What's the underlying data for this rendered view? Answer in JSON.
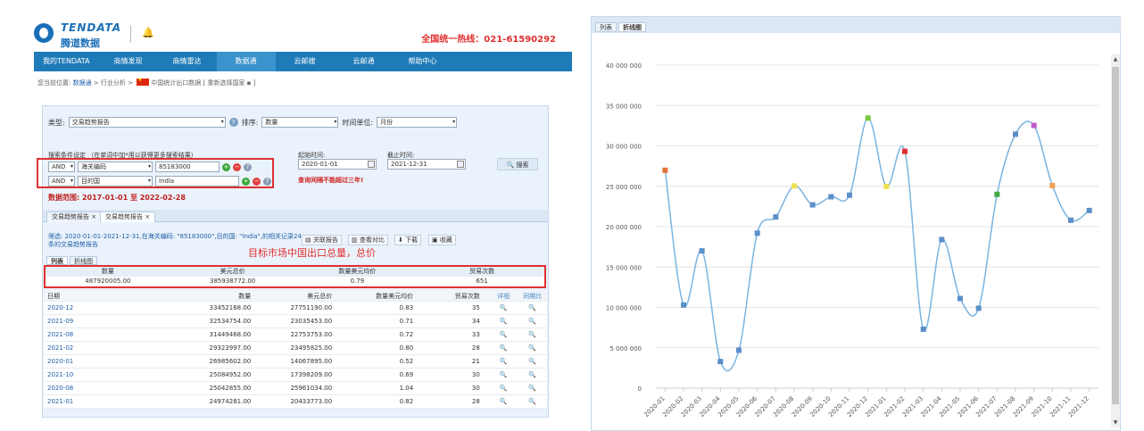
{
  "header": {
    "logo_en": "TENDATA",
    "logo_cn": "腾道数据",
    "hotline": "全国统一热线：021-61590292"
  },
  "nav": [
    "我的TENDATA",
    "商情发现",
    "商情雷达",
    "数据通",
    "云邮搜",
    "云邮通",
    "帮助中心"
  ],
  "nav_active": 3,
  "breadcrumb": {
    "prefix": "您当前位置:",
    "link1": "数据通",
    "sep1": " > ",
    "text2": "行业分析",
    "sep2": " > ",
    "text3": "中国统计出口数据",
    "reselect": "[ 重新选择国家 ▪ ]"
  },
  "filters": {
    "type_label": "类型:",
    "type_value": "交易趋势报告",
    "sort_label": "排序:",
    "sort_value": "数量",
    "unit_label": "时间单位:",
    "unit_value": "月份",
    "cond_label": "搜索条件设定 （在单词中加*用以获得更多搜索结果）",
    "cond1_op": "AND",
    "cond1_field": "海关编码",
    "cond1_value": "85183000",
    "cond2_op": "AND",
    "cond2_field": "目的国",
    "cond2_value": "India",
    "start_label": "起始时间:",
    "start_value": "2020-01-01",
    "end_label": "截止时间:",
    "end_value": "2021-12-31",
    "warning": "查询间隔不能超过三年!",
    "search_label": "搜索",
    "range_text": "数据范围: 2017-01-01 至 2022-02-28"
  },
  "report_tabs": [
    "交易趋势报告 ×",
    "交易趋势报告 ×"
  ],
  "description": "筛选: 2020-01-01-2021-12-31,在海关编码: \"85183000\",目的国: \"India\",的相关记录24条的交易趋势报告",
  "actions": [
    "关联报告",
    "查看对比",
    "下载",
    "收藏"
  ],
  "annotation": "目标市场中国出口总量，总价",
  "sub_tabs": [
    "列表",
    "折线图"
  ],
  "summary": {
    "headers": [
      "数量",
      "美元总价",
      "数量美元均价",
      "贸易次数"
    ],
    "values": [
      "487920005.00",
      "385938772.00",
      "0.79",
      "651"
    ]
  },
  "table": {
    "headers": [
      "日期",
      "数量",
      "美元总价",
      "数量美元均价",
      "贸易次数",
      "详细",
      "同期比"
    ],
    "rows": [
      [
        "2020-12",
        "33452168.00",
        "27751190.00",
        "0.83",
        "35"
      ],
      [
        "2021-09",
        "32534754.00",
        "23035453.00",
        "0.71",
        "34"
      ],
      [
        "2021-08",
        "31449468.00",
        "22753753.00",
        "0.72",
        "33"
      ],
      [
        "2021-02",
        "29323997.00",
        "23495825.00",
        "0.80",
        "28"
      ],
      [
        "2020-01",
        "26985602.00",
        "14067895.00",
        "0.52",
        "21"
      ],
      [
        "2021-10",
        "25084952.00",
        "17398209.00",
        "0.69",
        "30"
      ],
      [
        "2020-08",
        "25042855.00",
        "25961034.00",
        "1.04",
        "30"
      ],
      [
        "2021-01",
        "24974281.00",
        "20433773.00",
        "0.82",
        "28"
      ]
    ]
  },
  "chart_tabs": [
    "列表",
    "折线图"
  ],
  "chart_data": {
    "type": "line",
    "title": "",
    "xlabel": "",
    "ylabel": "",
    "ylim": [
      0,
      40000000
    ],
    "y_ticks": [
      0,
      5000000,
      10000000,
      15000000,
      20000000,
      25000000,
      30000000,
      35000000,
      40000000
    ],
    "y_tick_labels": [
      "0",
      "5 000 000",
      "10 000 000",
      "15 000 000",
      "20 000 000",
      "25 000 000",
      "30 000 000",
      "35 000 000",
      "40 000 000"
    ],
    "categories": [
      "2020-01",
      "2020-02",
      "2020-03",
      "2020-04",
      "2020-05",
      "2020-06",
      "2020-07",
      "2020-08",
      "2020-09",
      "2020-10",
      "2020-11",
      "2020-12",
      "2021-01",
      "2021-02",
      "2021-03",
      "2021-04",
      "2021-05",
      "2021-06",
      "2021-07",
      "2021-08",
      "2021-09",
      "2021-10",
      "2021-11",
      "2021-12"
    ],
    "series": [
      {
        "values": [
          26985602,
          10300000,
          17000000,
          3300000,
          4700000,
          19200000,
          21200000,
          25042855,
          22700000,
          23700000,
          23900000,
          33452168,
          24974281,
          29323997,
          7300000,
          18400000,
          11100000,
          9900000,
          24000000,
          31449468,
          32534754,
          25084952,
          20800000,
          22000000
        ],
        "color": "#7ab4e0"
      }
    ],
    "marker_colors": [
      "#e8733a",
      "#5b8fc9",
      "#5b8fc9",
      "#5b8fc9",
      "#5b8fc9",
      "#5b8fc9",
      "#5b8fc9",
      "#f0e050",
      "#5b8fc9",
      "#5b8fc9",
      "#5b8fc9",
      "#7ac943",
      "#f0e050",
      "#e03030",
      "#5b8fc9",
      "#5b8fc9",
      "#5b8fc9",
      "#5b8fc9",
      "#43a843",
      "#5b8fc9",
      "#c05ac9",
      "#f0a050",
      "#5b8fc9",
      "#5b8fc9"
    ],
    "grid": true,
    "legend": "none"
  }
}
